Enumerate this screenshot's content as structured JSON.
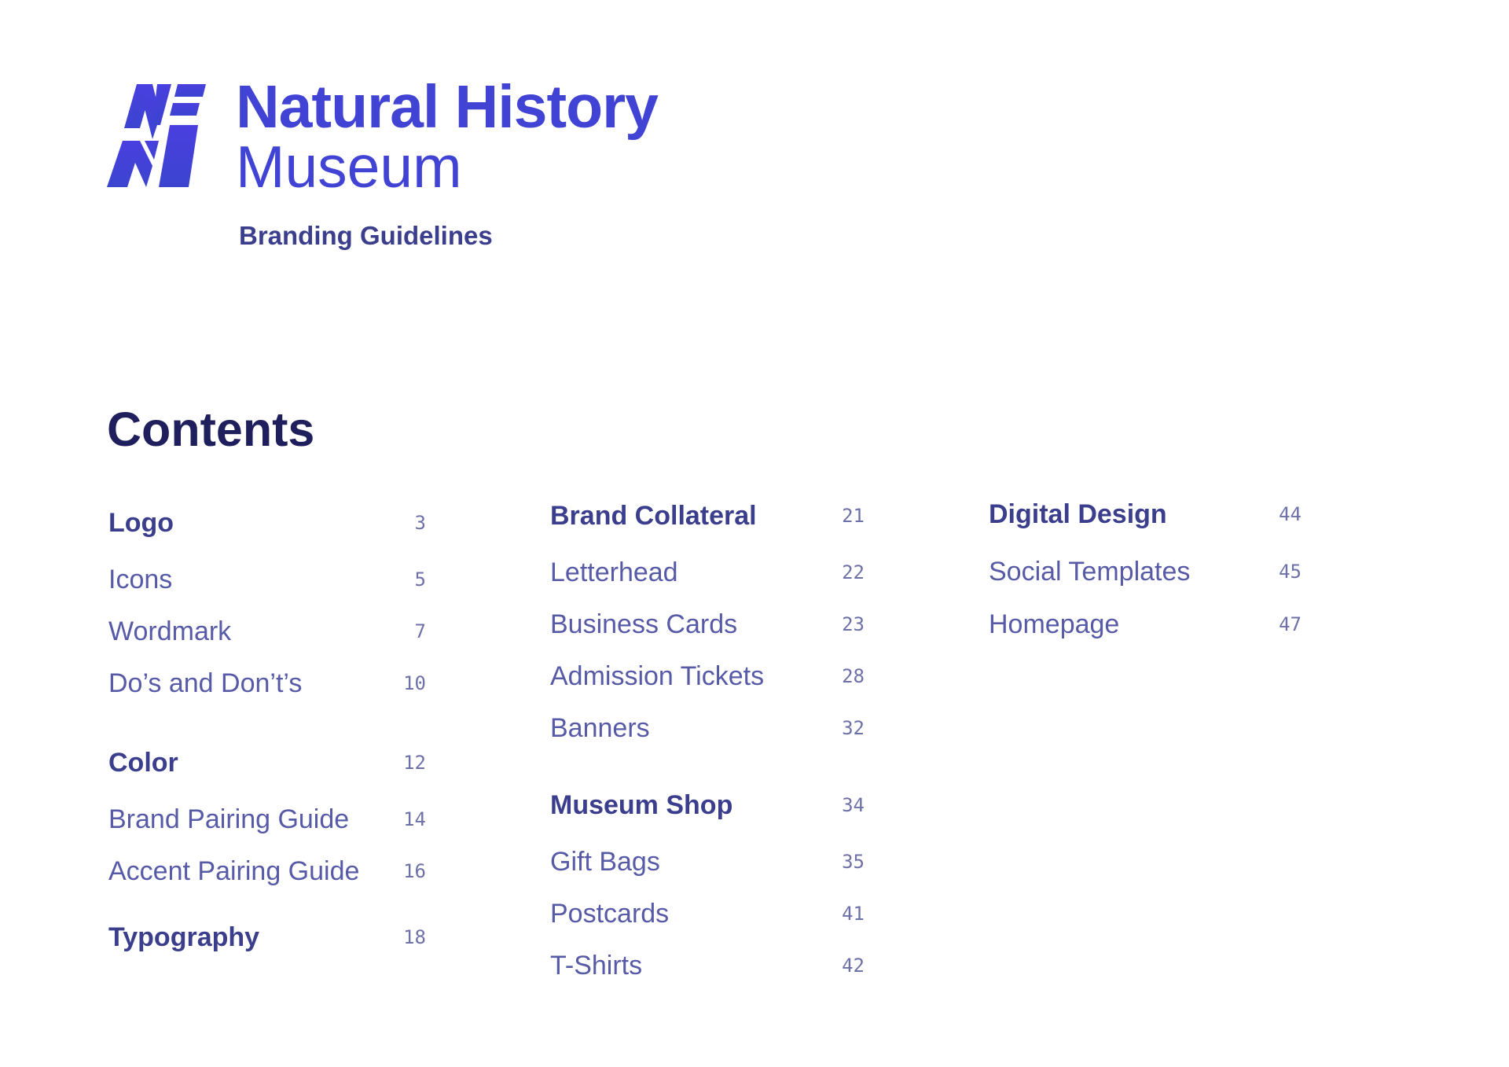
{
  "brand": {
    "logo_icon": "nhm-monogram-icon",
    "title": "Natural History",
    "subtitle": "Museum",
    "document_title": "Branding Guidelines",
    "colors": {
      "brand": "#4143d4",
      "heading": "#1e1f5c",
      "section": "#3b3e8c",
      "item": "#575aa6",
      "page_number": "#6e70a8"
    }
  },
  "contents": {
    "heading": "Contents",
    "columns": [
      {
        "entries": [
          {
            "type": "section",
            "label": "Logo",
            "page": "3"
          },
          {
            "type": "item",
            "label": "Icons",
            "page": "5"
          },
          {
            "type": "item",
            "label": "Wordmark",
            "page": "7"
          },
          {
            "type": "item",
            "label": "Do’s and Don’t’s",
            "page": "10"
          },
          {
            "type": "section",
            "label": "Color",
            "page": "12"
          },
          {
            "type": "item",
            "label": "Brand Pairing Guide",
            "page": "14"
          },
          {
            "type": "item",
            "label": "Accent Pairing Guide",
            "page": "16"
          },
          {
            "type": "section",
            "label": "Typography",
            "page": "18"
          }
        ]
      },
      {
        "entries": [
          {
            "type": "section",
            "label": "Brand Collateral",
            "page": "21"
          },
          {
            "type": "item",
            "label": "Letterhead",
            "page": "22"
          },
          {
            "type": "item",
            "label": "Business Cards",
            "page": "23"
          },
          {
            "type": "item",
            "label": "Admission Tickets",
            "page": "28"
          },
          {
            "type": "item",
            "label": "Banners",
            "page": "32"
          },
          {
            "type": "section",
            "label": "Museum Shop",
            "page": "34"
          },
          {
            "type": "item",
            "label": "Gift Bags",
            "page": "35"
          },
          {
            "type": "item",
            "label": "Postcards",
            "page": "41"
          },
          {
            "type": "item",
            "label": "T-Shirts",
            "page": "42"
          }
        ]
      },
      {
        "entries": [
          {
            "type": "section",
            "label": "Digital Design",
            "page": "44"
          },
          {
            "type": "item",
            "label": "Social Templates",
            "page": "45"
          },
          {
            "type": "item",
            "label": "Homepage",
            "page": "47"
          }
        ]
      }
    ]
  }
}
